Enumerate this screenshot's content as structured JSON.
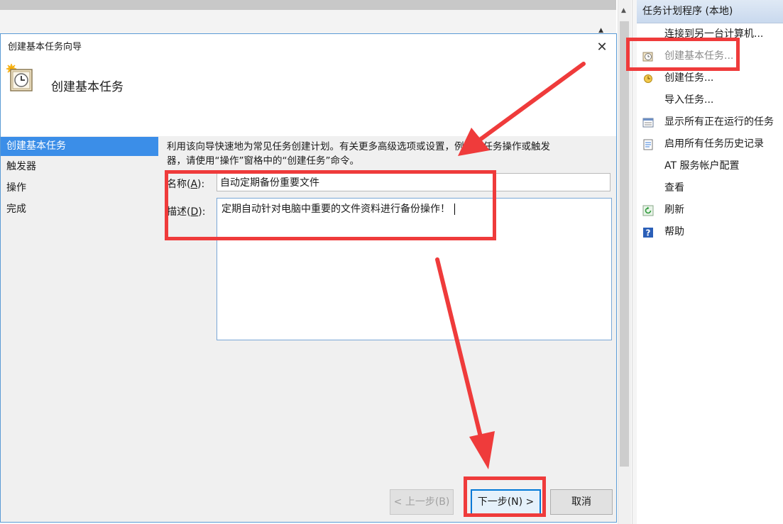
{
  "dialog": {
    "window_title": "创建基本任务向导",
    "header_title": "创建基本任务",
    "steps": [
      {
        "label": "创建基本任务"
      },
      {
        "label": "触发器"
      },
      {
        "label": "操作"
      },
      {
        "label": "完成"
      }
    ],
    "intro_line1": "利用该向导快速地为常见任务创建计划。有关更多高级选项或设置，例如多任务操作或触发",
    "intro_line2": "器，请使用“操作”窗格中的“创建任务”命令。",
    "name_label": "名称(",
    "name_label_key": "A",
    "name_label_end": "):",
    "name_value": "自动定期备份重要文件",
    "desc_label": "描述(",
    "desc_label_key": "D",
    "desc_label_end": "):",
    "desc_value": "定期自动针对电脑中重要的文件资料进行备份操作！",
    "back_button": "< 上一步(B)",
    "next_button": "下一步(N) >",
    "cancel_button": "取消"
  },
  "actions_pane": {
    "header": "任务计划程序 (本地)",
    "items": [
      {
        "label": "连接到另一台计算机...",
        "icon": "none",
        "enabled": true
      },
      {
        "label": "创建基本任务...",
        "icon": "clock-wizard-icon",
        "enabled": false
      },
      {
        "label": "创建任务...",
        "icon": "task-icon",
        "enabled": true
      },
      {
        "label": "导入任务...",
        "icon": "none",
        "enabled": true
      },
      {
        "label": "显示所有正在运行的任务",
        "icon": "running-tasks-icon",
        "enabled": true
      },
      {
        "label": "启用所有任务历史记录",
        "icon": "history-icon",
        "enabled": true
      },
      {
        "label": "AT 服务帐户配置",
        "icon": "none",
        "enabled": true
      },
      {
        "label": "查看",
        "icon": "none",
        "enabled": true
      },
      {
        "label": "刷新",
        "icon": "refresh-icon",
        "enabled": true
      },
      {
        "label": "帮助",
        "icon": "help-icon",
        "enabled": true
      }
    ]
  },
  "colors": {
    "accent": "#3b8ee8",
    "annotation_red": "#ef3b3b",
    "focus_blue": "#0078d7"
  }
}
